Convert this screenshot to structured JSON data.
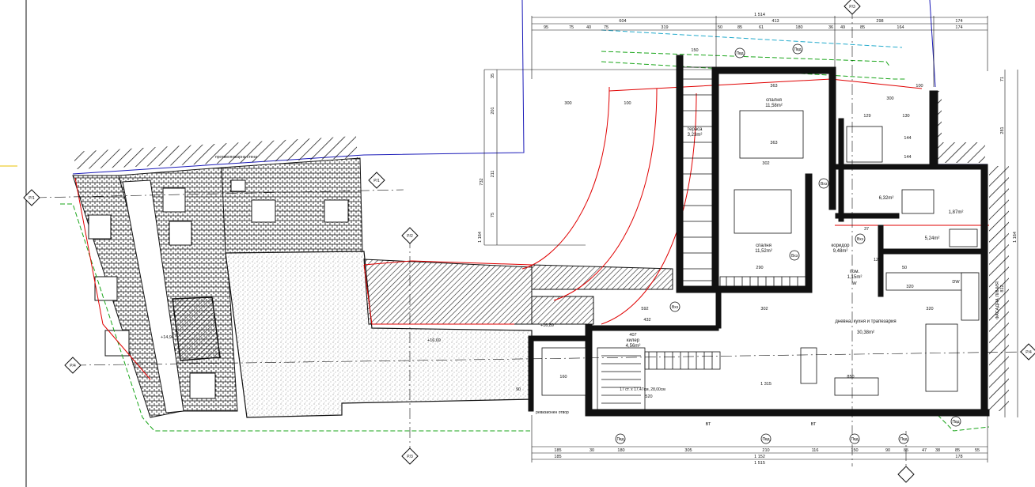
{
  "top_dimensions": {
    "overall": "1 514",
    "row1": [
      "604",
      "413",
      "298",
      "174"
    ],
    "row1_b": [
      "174"
    ],
    "row2": [
      "95",
      "75",
      "40",
      "75",
      "319",
      "50",
      "85",
      "61",
      "180",
      "36",
      "49",
      "85",
      "164"
    ]
  },
  "bottom_dimensions": {
    "row1": [
      "185",
      "30",
      "180",
      "305",
      "210",
      "116",
      "150",
      "90",
      "85",
      "47",
      "38",
      "85",
      "55"
    ],
    "row2": [
      "185",
      "1 152",
      "178"
    ],
    "overall": "1 515"
  },
  "right_dimensions": [
    "71",
    "281",
    "1 164",
    "812"
  ],
  "left_dimensions": [
    "201",
    "732",
    "1 164",
    "211",
    "75",
    "35"
  ],
  "rooms": [
    {
      "id": "bedroom1",
      "name": "спалня",
      "area": "11,58m²"
    },
    {
      "id": "bedroom2",
      "name": "спалня",
      "area": "11,52m²"
    },
    {
      "id": "terrace",
      "name": "тераса",
      "area": "3,23m²"
    },
    {
      "id": "corridor",
      "name": "коридор",
      "area": "9,48m²"
    },
    {
      "id": "bath1",
      "name": "",
      "area": "6,32m²"
    },
    {
      "id": "wc",
      "name": "",
      "area": "1,87m²"
    },
    {
      "id": "utility",
      "name": "пом.",
      "area": "1,15m²"
    },
    {
      "id": "bath2",
      "name": "",
      "area": "5,24m²"
    },
    {
      "id": "living",
      "name": "дневна, кухня и трапезария",
      "area": "30,38m²"
    },
    {
      "id": "storage",
      "name": "килер",
      "area": "4,56m²"
    }
  ],
  "levels": [
    "+16,89",
    "+16,69",
    "+14,94"
  ],
  "axis_tags": [
    "P/1",
    "P/1",
    "P/2",
    "P/4",
    "P/4",
    "P/3",
    "P/3"
  ],
  "door_tags": [
    "Пвд",
    "Пвд",
    "Вхз",
    "Вхз",
    "Вхз",
    "Вхз",
    "Пвд",
    "Пвд",
    "Пвд",
    "Пвд",
    "Пвд"
  ],
  "inner_dims": [
    "150",
    "363",
    "300",
    "100",
    "300",
    "100",
    "363",
    "302",
    "290",
    "302",
    "320",
    "432",
    "407",
    "592",
    "850",
    "1 315",
    "160",
    "90",
    "129",
    "130",
    "144",
    "144",
    "37",
    "12",
    "50",
    "320"
  ],
  "labels": {
    "dw": "DW",
    "w": "W",
    "bt1": "ВТ",
    "bt2": "ВТ",
    "stairs": "17 ст. х 17,47см, 28,00см",
    "stairs_dim": "520",
    "wall_note": "ревизионен отвор",
    "wall_note2": "противопожарна стена",
    "right_note": "ФАСАДНА ЛИНИЯ"
  },
  "colors": {
    "wall": "#111111",
    "red_line": "#e00000",
    "blue_line": "#1a1ab8",
    "green_dash": "#1aa51a",
    "cyan_dash": "#22aacc",
    "hatch": "#222222"
  }
}
